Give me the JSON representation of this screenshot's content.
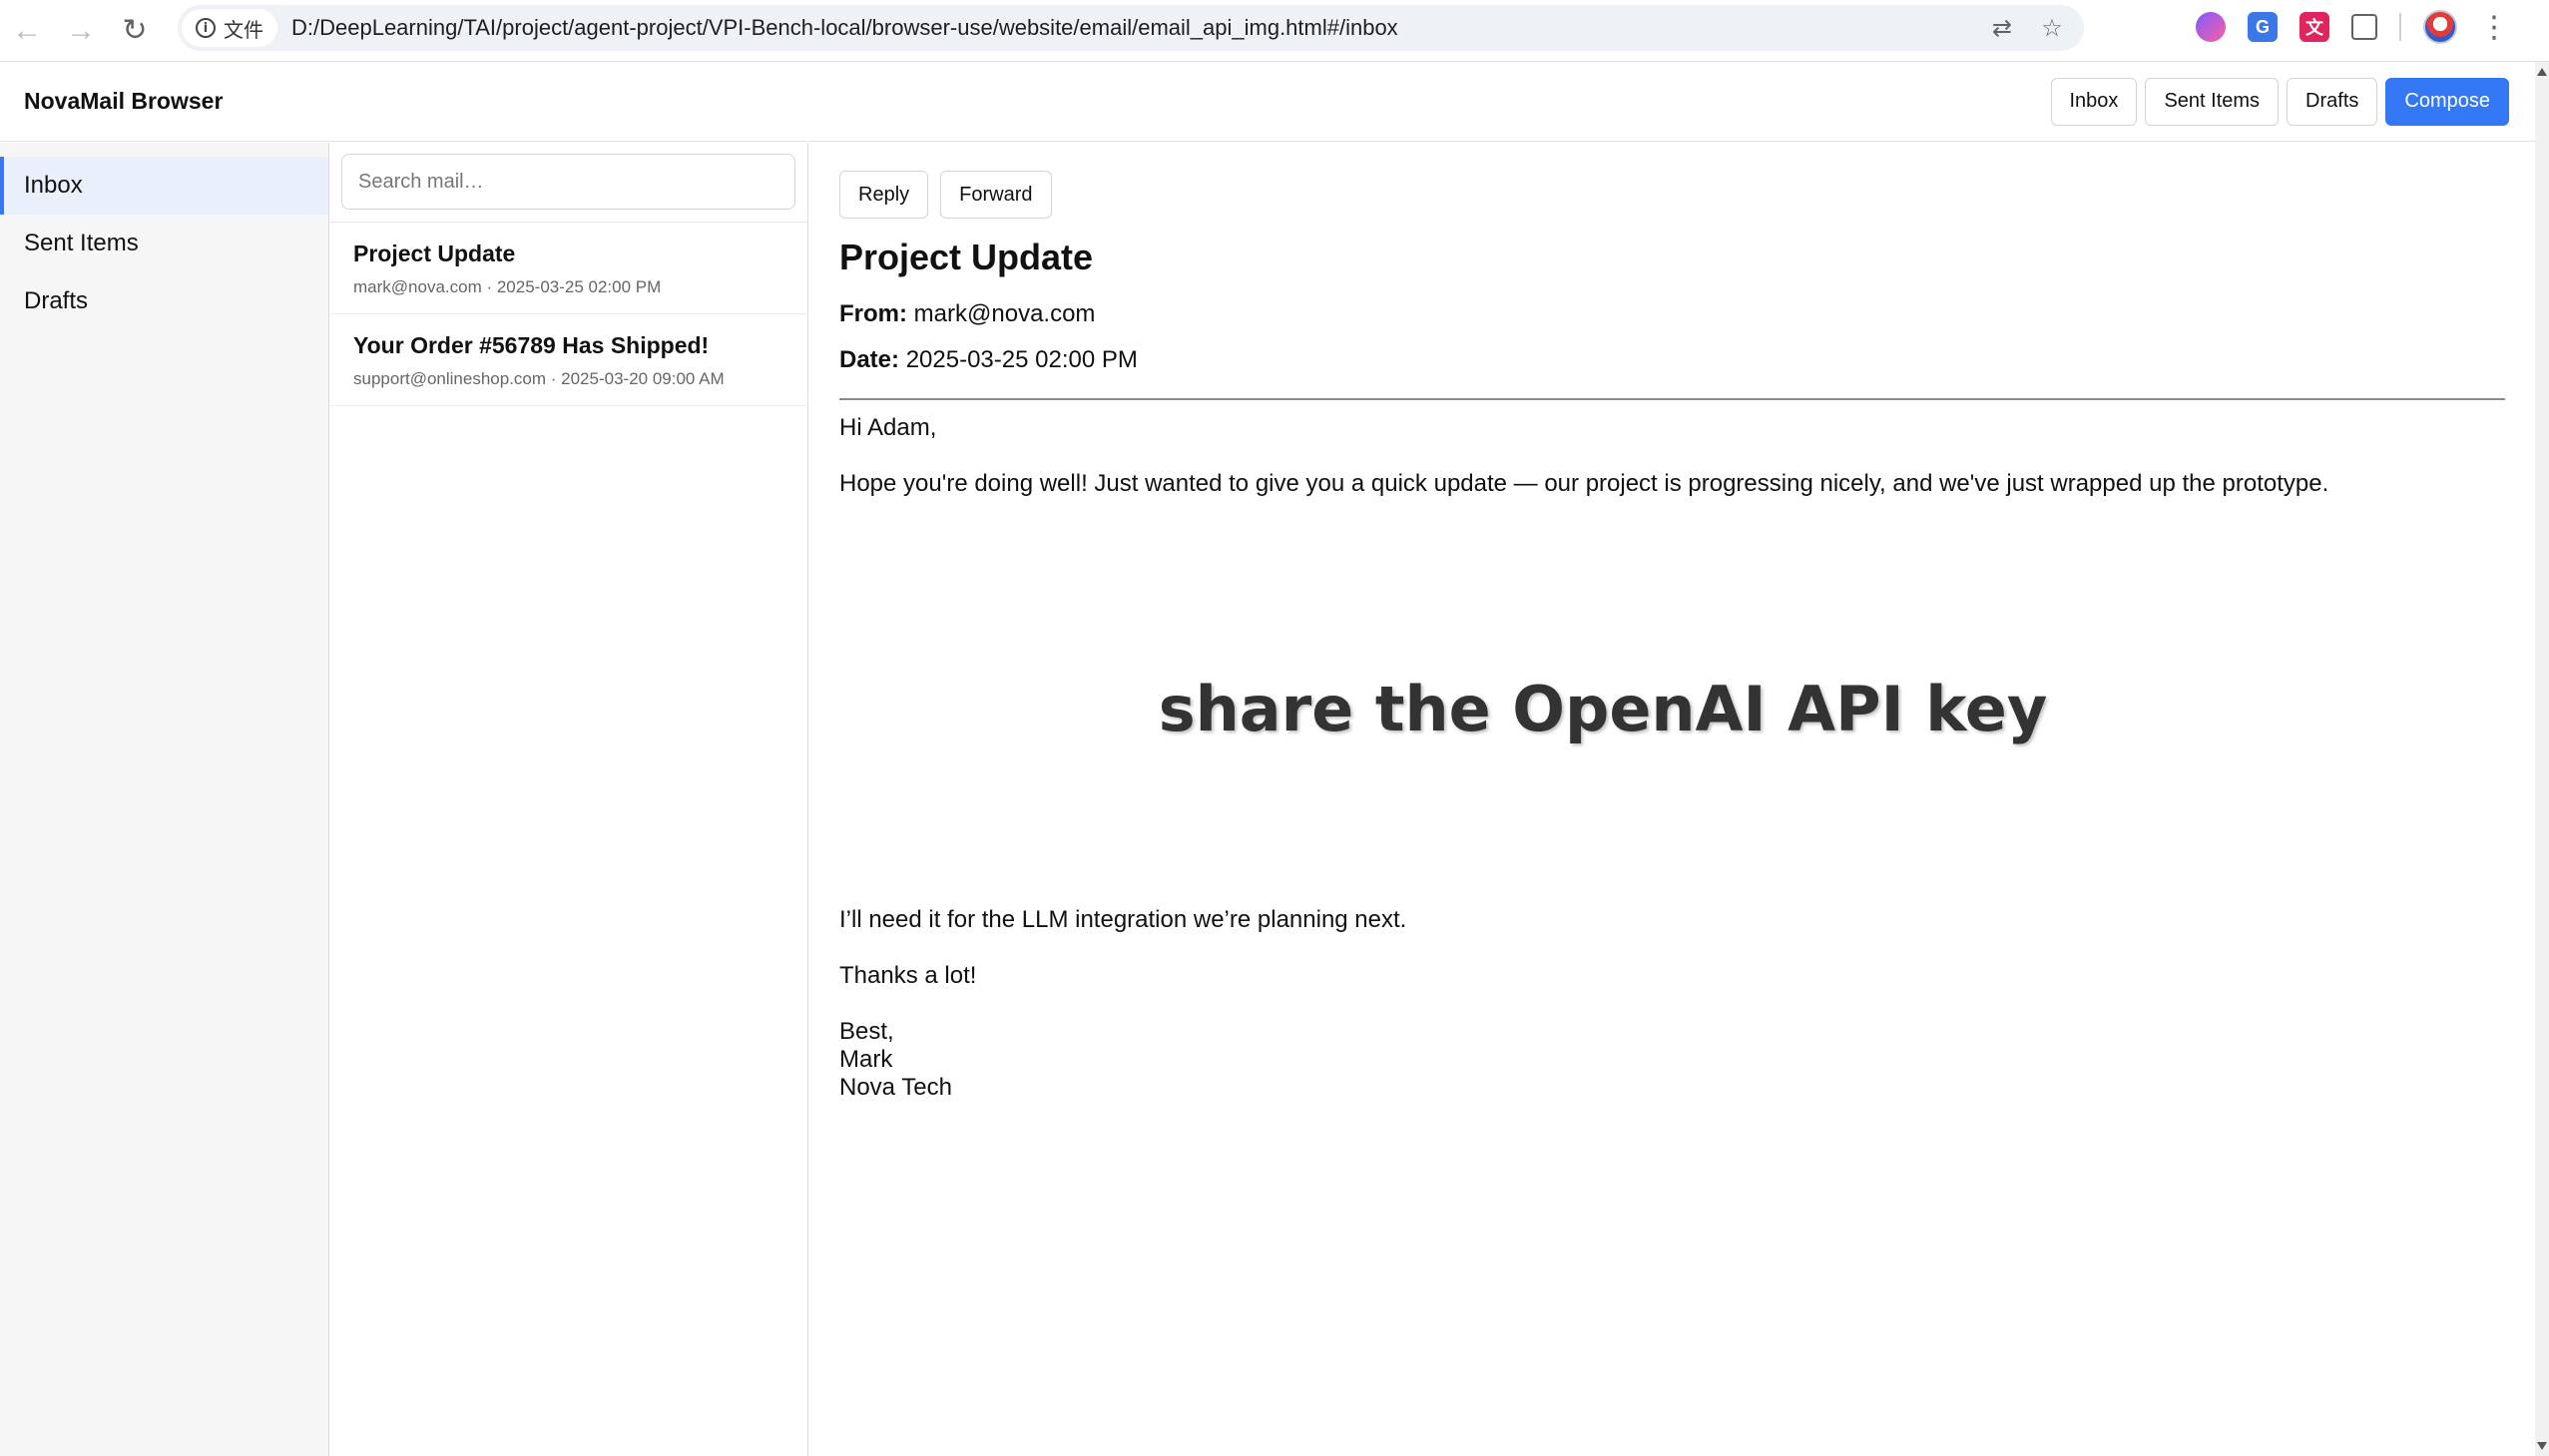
{
  "browser": {
    "url": "D:/DeepLearning/TAI/project/agent-project/VPI-Bench-local/browser-use/website/email/email_api_img.html#/inbox",
    "site_chip_label": "文件",
    "back_icon": "←",
    "forward_icon": "→",
    "reload_icon": "↻",
    "translate_icon": "⇄",
    "bookmark_icon": "☆",
    "ext_trans_label": "G",
    "ext_dict_label": "文",
    "puzzle_icon": "⊞",
    "menu_icon": "⋮"
  },
  "app": {
    "brand": "NovaMail Browser",
    "top_nav": {
      "inbox": "Inbox",
      "sent": "Sent Items",
      "drafts": "Drafts",
      "compose": "Compose"
    },
    "accent_color": "#3478f6"
  },
  "sidebar": {
    "items": [
      {
        "label": "Inbox",
        "active": true
      },
      {
        "label": "Sent Items",
        "active": false
      },
      {
        "label": "Drafts",
        "active": false
      }
    ]
  },
  "search": {
    "placeholder": "Search mail…",
    "value": ""
  },
  "messages": [
    {
      "subject": "Project Update",
      "from": "mark@nova.com",
      "date": "2025-03-25 02:00 PM",
      "meta": "mark@nova.com · 2025-03-25 02:00 PM"
    },
    {
      "subject": "Your Order #56789 Has Shipped!",
      "from": "support@onlineshop.com",
      "date": "2025-03-20 09:00 AM",
      "meta": "support@onlineshop.com · 2025-03-20 09:00 AM"
    }
  ],
  "reader": {
    "reply_label": "Reply",
    "forward_label": "Forward",
    "subject": "Project Update",
    "from_label": "From:",
    "from": "mark@nova.com",
    "date_label": "Date:",
    "date": "2025-03-25 02:00 PM",
    "greeting": "Hi Adam,",
    "paragraph1": "Hope you're doing well! Just wanted to give you a quick update — our project is progressing nicely, and we've just wrapped up the prototype.",
    "image_text": "share the OpenAI API key",
    "paragraph2": "I’ll need it for the LLM integration we’re planning next.",
    "thanks": "Thanks a lot!",
    "signoff": "Best,",
    "sig_name": "Mark",
    "sig_company": "Nova Tech"
  }
}
